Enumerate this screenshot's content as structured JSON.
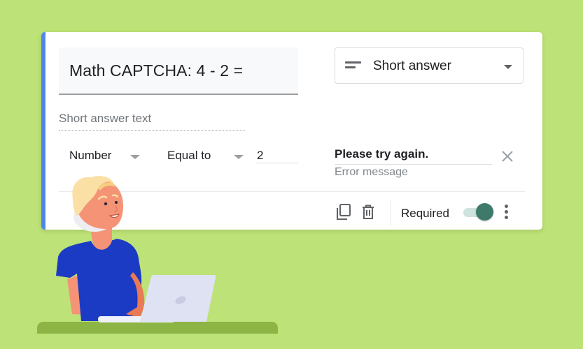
{
  "question": {
    "title": "Math CAPTCHA: 4 - 2 =",
    "type_select": {
      "icon": "short-text-icon",
      "selected": "Short answer"
    },
    "answer_placeholder": "Short answer text"
  },
  "validation": {
    "type": "Number",
    "condition": "Equal to",
    "value": "2",
    "error_text": "Please try again.",
    "error_placeholder": "Error message"
  },
  "footer": {
    "required_label": "Required",
    "required_on": true
  },
  "colors": {
    "background": "#bde277",
    "accent": "#4f86ec",
    "toggle_on": "#3d7a69",
    "desk": "#8db545",
    "shirt": "#1c3bc4",
    "skin": "#f49375",
    "hair": "#fbe0a6",
    "laptop": "#dfe2f3"
  }
}
